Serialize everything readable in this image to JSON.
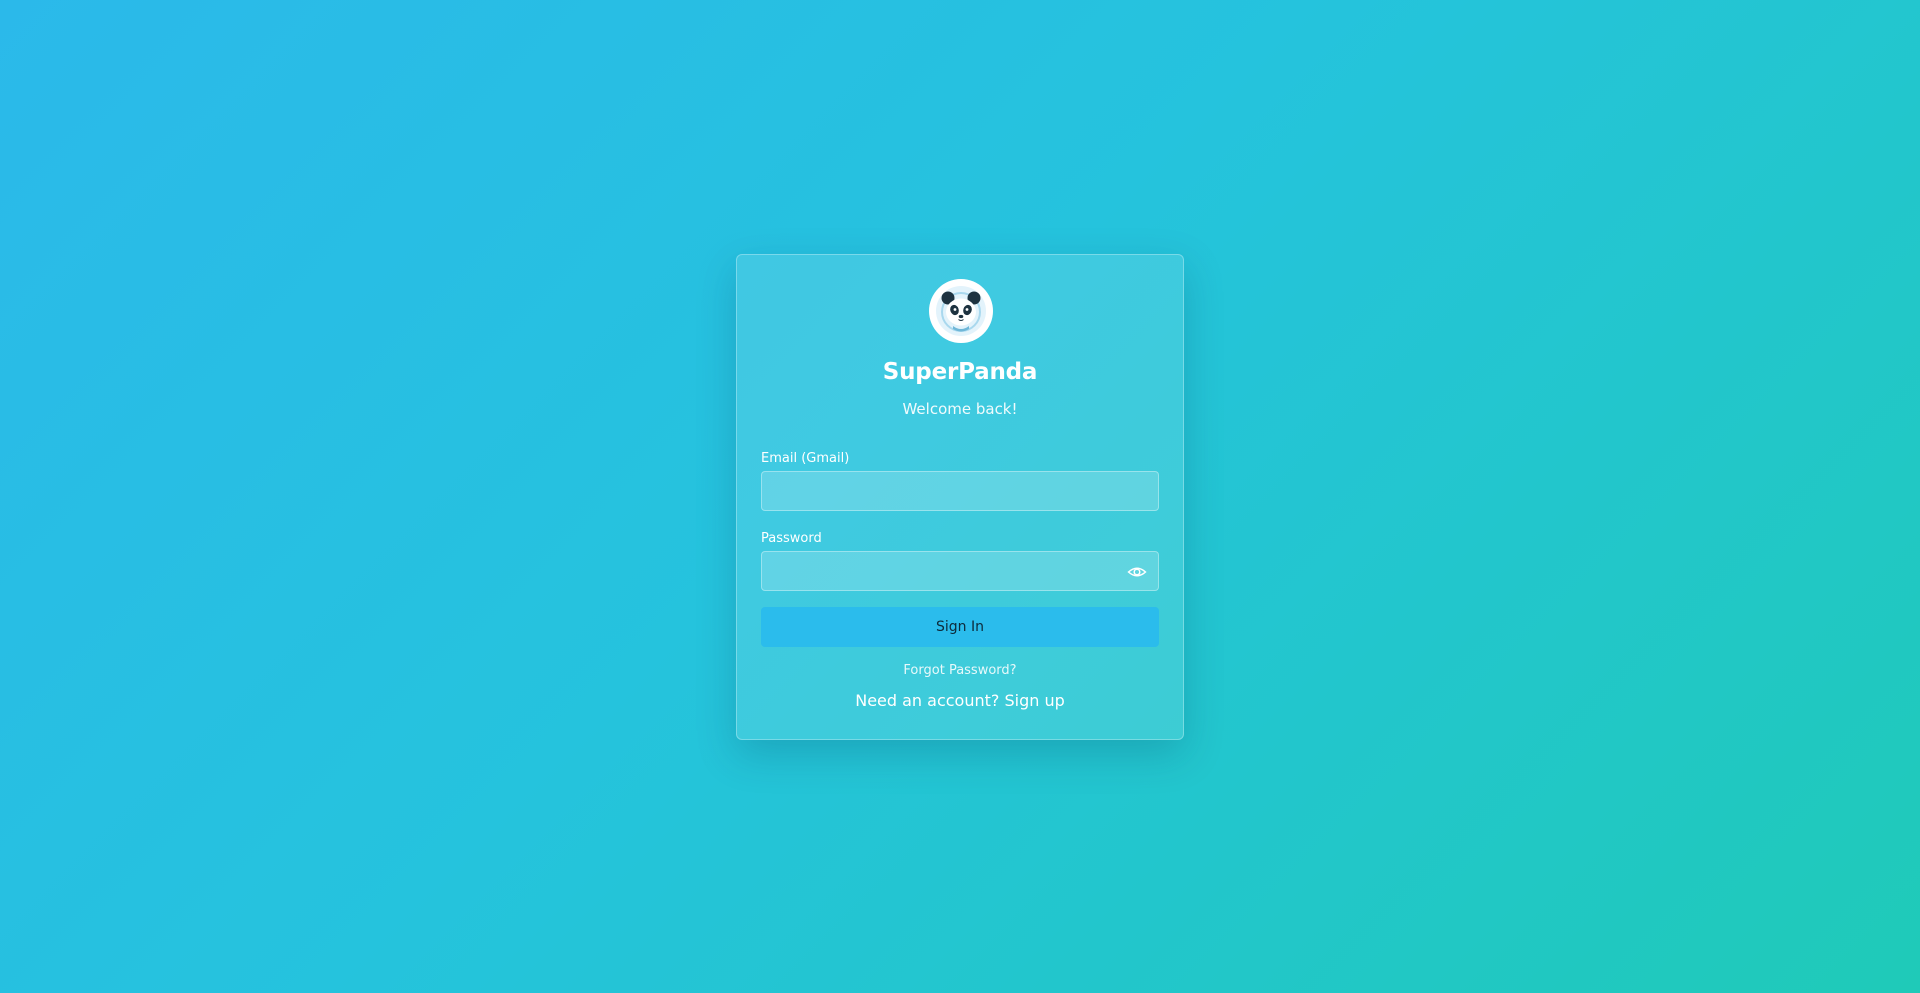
{
  "app": {
    "title": "SuperPanda",
    "subtitle": "Welcome back!",
    "logo_icon": "panda-icon"
  },
  "form": {
    "email_label": "Email (Gmail)",
    "email_value": "",
    "password_label": "Password",
    "password_value": "",
    "password_toggle_icon": "eye-icon",
    "submit_label": "Sign In"
  },
  "links": {
    "forgot_password": "Forgot Password?",
    "need_account": "Need an account?",
    "sign_up": "Sign up"
  },
  "colors": {
    "background_start": "#2bb9ea",
    "background_end": "#1fcab8",
    "button": "#2bbcec"
  }
}
